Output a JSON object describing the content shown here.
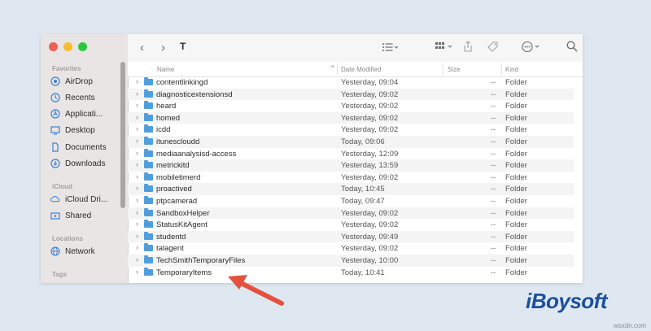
{
  "window": {
    "title": "T"
  },
  "sidebar": {
    "sections": [
      {
        "label": "Favorites"
      },
      {
        "label": "iCloud"
      },
      {
        "label": "Locations"
      },
      {
        "label": "Tags"
      }
    ],
    "items": [
      {
        "label": "AirDrop",
        "icon": "airdrop-icon"
      },
      {
        "label": "Recents",
        "icon": "clock-icon"
      },
      {
        "label": "Applicati...",
        "icon": "applications-icon"
      },
      {
        "label": "Desktop",
        "icon": "desktop-icon"
      },
      {
        "label": "Documents",
        "icon": "document-icon"
      },
      {
        "label": "Downloads",
        "icon": "download-icon"
      },
      {
        "label": "iCloud Dri...",
        "icon": "cloud-icon"
      },
      {
        "label": "Shared",
        "icon": "shared-folder-icon"
      },
      {
        "label": "Network",
        "icon": "globe-icon"
      }
    ]
  },
  "columns": {
    "name": "Name",
    "date": "Date Modified",
    "size": "Size",
    "kind": "Kind"
  },
  "rows": [
    {
      "name": "contentlinkingd",
      "date": "Yesterday, 09:04",
      "size": "--",
      "kind": "Folder"
    },
    {
      "name": "diagnosticextensionsd",
      "date": "Yesterday, 09:02",
      "size": "--",
      "kind": "Folder"
    },
    {
      "name": "heard",
      "date": "Yesterday, 09:02",
      "size": "--",
      "kind": "Folder"
    },
    {
      "name": "homed",
      "date": "Yesterday, 09:02",
      "size": "--",
      "kind": "Folder"
    },
    {
      "name": "icdd",
      "date": "Yesterday, 09:02",
      "size": "--",
      "kind": "Folder"
    },
    {
      "name": "itunescloudd",
      "date": "Today, 09:06",
      "size": "--",
      "kind": "Folder"
    },
    {
      "name": "mediaanalysisd-access",
      "date": "Yesterday, 12:09",
      "size": "--",
      "kind": "Folder"
    },
    {
      "name": "metrickitd",
      "date": "Yesterday, 13:59",
      "size": "--",
      "kind": "Folder"
    },
    {
      "name": "mobiletimerd",
      "date": "Yesterday, 09:02",
      "size": "--",
      "kind": "Folder"
    },
    {
      "name": "proactived",
      "date": "Today, 10:45",
      "size": "--",
      "kind": "Folder"
    },
    {
      "name": "ptpcamerad",
      "date": "Today, 09:47",
      "size": "--",
      "kind": "Folder"
    },
    {
      "name": "SandboxHelper",
      "date": "Yesterday, 09:02",
      "size": "--",
      "kind": "Folder"
    },
    {
      "name": "StatusKitAgent",
      "date": "Yesterday, 09:02",
      "size": "--",
      "kind": "Folder"
    },
    {
      "name": "studentd",
      "date": "Yesterday, 09:49",
      "size": "--",
      "kind": "Folder"
    },
    {
      "name": "talagent",
      "date": "Yesterday, 09:02",
      "size": "--",
      "kind": "Folder"
    },
    {
      "name": "TechSmithTemporaryFiles",
      "date": "Yesterday, 10:00",
      "size": "--",
      "kind": "Folder"
    },
    {
      "name": "TemporaryItems",
      "date": "Today, 10:41",
      "size": "--",
      "kind": "Folder"
    }
  ],
  "brand": {
    "logo": "iBoysoft",
    "watermark": "wsxdn.com"
  },
  "colors": {
    "folder": "#4f9fe0",
    "arrow": "#e5513f",
    "logo": "#1c4f9c"
  }
}
